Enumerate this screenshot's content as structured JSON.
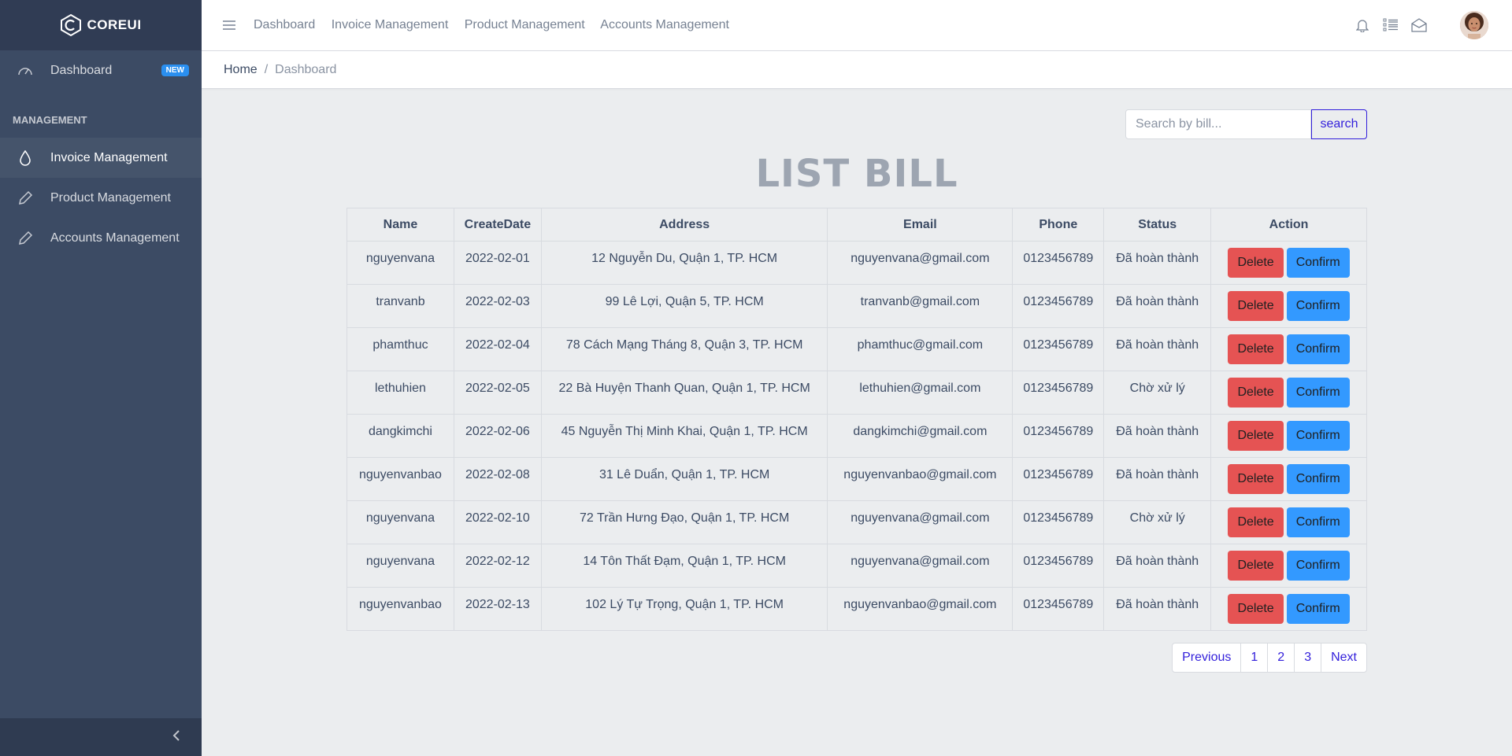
{
  "brand": {
    "name": "COREUI"
  },
  "sidebar": {
    "dashboard": {
      "label": "Dashboard",
      "badge": "NEW"
    },
    "section_title": "MANAGEMENT",
    "items": [
      {
        "label": "Invoice Management",
        "icon": "drop-icon",
        "active": true
      },
      {
        "label": "Product Management",
        "icon": "pencil-icon",
        "active": false
      },
      {
        "label": "Accounts Management",
        "icon": "pencil-icon",
        "active": false
      }
    ]
  },
  "header": {
    "nav": [
      "Dashboard",
      "Invoice Management",
      "Product Management",
      "Accounts Management"
    ],
    "icons": [
      "bell-icon",
      "list-icon",
      "envelope-icon"
    ]
  },
  "breadcrumb": {
    "home": "Home",
    "current": "Dashboard"
  },
  "search": {
    "placeholder": "Search by bill...",
    "button_label": "search"
  },
  "page_title": "LIST BILL",
  "table": {
    "columns": [
      "Name",
      "CreateDate",
      "Address",
      "Email",
      "Phone",
      "Status",
      "Action"
    ],
    "rows": [
      {
        "name": "nguyenvana",
        "date": "2022-02-01",
        "address": "12 Nguyễn Du, Quận 1, TP. HCM",
        "email": "nguyenvana@gmail.com",
        "phone": "0123456789",
        "status": "Đã hoàn thành"
      },
      {
        "name": "tranvanb",
        "date": "2022-02-03",
        "address": "99 Lê Lợi, Quận 5, TP. HCM",
        "email": "tranvanb@gmail.com",
        "phone": "0123456789",
        "status": "Đã hoàn thành"
      },
      {
        "name": "phamthuc",
        "date": "2022-02-04",
        "address": "78 Cách Mạng Tháng 8, Quận 3, TP. HCM",
        "email": "phamthuc@gmail.com",
        "phone": "0123456789",
        "status": "Đã hoàn thành"
      },
      {
        "name": "lethuhien",
        "date": "2022-02-05",
        "address": "22 Bà Huyện Thanh Quan, Quận 1, TP. HCM",
        "email": "lethuhien@gmail.com",
        "phone": "0123456789",
        "status": "Chờ xử lý"
      },
      {
        "name": "dangkimchi",
        "date": "2022-02-06",
        "address": "45 Nguyễn Thị Minh Khai, Quận 1, TP. HCM",
        "email": "dangkimchi@gmail.com",
        "phone": "0123456789",
        "status": "Đã hoàn thành"
      },
      {
        "name": "nguyenvanbao",
        "date": "2022-02-08",
        "address": "31 Lê Duẩn, Quận 1, TP. HCM",
        "email": "nguyenvanbao@gmail.com",
        "phone": "0123456789",
        "status": "Đã hoàn thành"
      },
      {
        "name": "nguyenvana",
        "date": "2022-02-10",
        "address": "72 Trần Hưng Đạo, Quận 1, TP. HCM",
        "email": "nguyenvana@gmail.com",
        "phone": "0123456789",
        "status": "Chờ xử lý"
      },
      {
        "name": "nguyenvana",
        "date": "2022-02-12",
        "address": "14 Tôn Thất Đạm, Quận 1, TP. HCM",
        "email": "nguyenvana@gmail.com",
        "phone": "0123456789",
        "status": "Đã hoàn thành"
      },
      {
        "name": "nguyenvanbao",
        "date": "2022-02-13",
        "address": "102 Lý Tự Trọng, Quận 1, TP. HCM",
        "email": "nguyenvanbao@gmail.com",
        "phone": "0123456789",
        "status": "Đã hoàn thành"
      }
    ],
    "delete_label": "Delete",
    "confirm_label": "Confirm"
  },
  "pagination": {
    "previous": "Previous",
    "pages": [
      "1",
      "2",
      "3"
    ],
    "next": "Next"
  },
  "colors": {
    "sidebar": "#3c4b64",
    "brand_bar": "#303c54",
    "delete": "#e55353",
    "confirm": "#3399ff",
    "primary": "#321fdb"
  }
}
